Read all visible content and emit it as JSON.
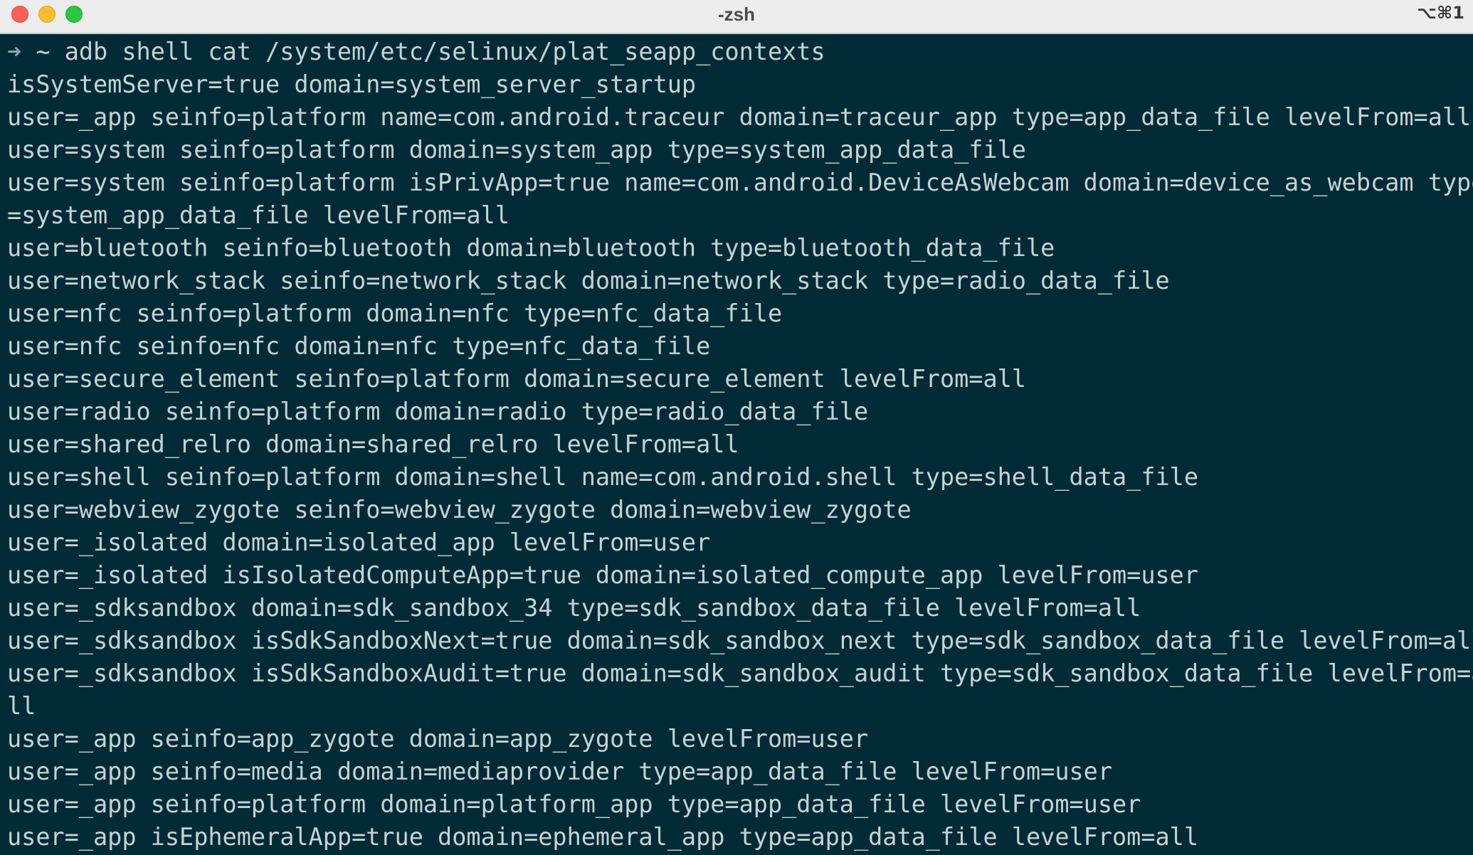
{
  "window": {
    "title": "-zsh",
    "shortcut": "⌥⌘1"
  },
  "terminal": {
    "prompt_symbol": "➜",
    "prompt_cwd": " ~ ",
    "command": "adb shell cat /system/etc/selinux/plat_seapp_contexts",
    "lines": [
      "isSystemServer=true domain=system_server_startup",
      "user=_app seinfo=platform name=com.android.traceur domain=traceur_app type=app_data_file levelFrom=all",
      "user=system seinfo=platform domain=system_app type=system_app_data_file",
      "user=system seinfo=platform isPrivApp=true name=com.android.DeviceAsWebcam domain=device_as_webcam type",
      "=system_app_data_file levelFrom=all",
      "user=bluetooth seinfo=bluetooth domain=bluetooth type=bluetooth_data_file",
      "user=network_stack seinfo=network_stack domain=network_stack type=radio_data_file",
      "user=nfc seinfo=platform domain=nfc type=nfc_data_file",
      "user=nfc seinfo=nfc domain=nfc type=nfc_data_file",
      "user=secure_element seinfo=platform domain=secure_element levelFrom=all",
      "user=radio seinfo=platform domain=radio type=radio_data_file",
      "user=shared_relro domain=shared_relro levelFrom=all",
      "user=shell seinfo=platform domain=shell name=com.android.shell type=shell_data_file",
      "user=webview_zygote seinfo=webview_zygote domain=webview_zygote",
      "user=_isolated domain=isolated_app levelFrom=user",
      "user=_isolated isIsolatedComputeApp=true domain=isolated_compute_app levelFrom=user",
      "user=_sdksandbox domain=sdk_sandbox_34 type=sdk_sandbox_data_file levelFrom=all",
      "user=_sdksandbox isSdkSandboxNext=true domain=sdk_sandbox_next type=sdk_sandbox_data_file levelFrom=all",
      "user=_sdksandbox isSdkSandboxAudit=true domain=sdk_sandbox_audit type=sdk_sandbox_data_file levelFrom=a",
      "ll",
      "user=_app seinfo=app_zygote domain=app_zygote levelFrom=user",
      "user=_app seinfo=media domain=mediaprovider type=app_data_file levelFrom=user",
      "user=_app seinfo=platform domain=platform_app type=app_data_file levelFrom=user",
      "user=_app isEphemeralApp=true domain=ephemeral_app type=app_data_file levelFrom=all"
    ]
  },
  "colors": {
    "background": "#002b36",
    "text": "#c7d2d4",
    "titlebar": "#ededed"
  }
}
